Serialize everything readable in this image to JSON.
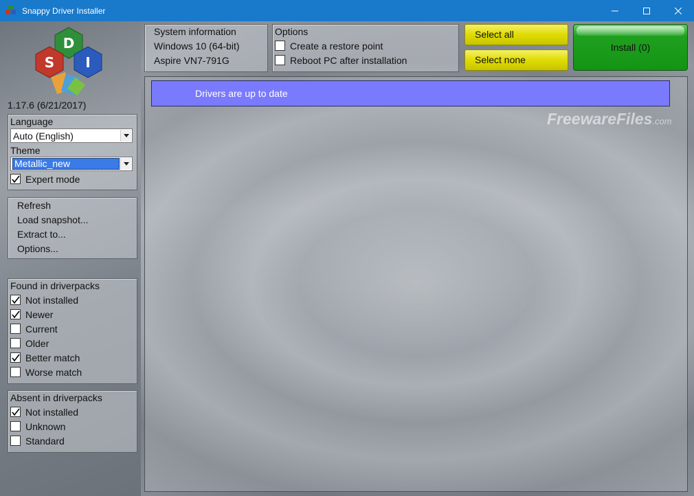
{
  "window": {
    "title": "Snappy Driver Installer"
  },
  "logo": {
    "letters": [
      "D",
      "S",
      "I"
    ]
  },
  "version": "1.17.6 (6/21/2017)",
  "settings": {
    "language_label": "Language",
    "language_value": "Auto (English)",
    "theme_label": "Theme",
    "theme_value": "Metallic_new",
    "expert_mode_label": "Expert mode",
    "expert_mode_checked": true
  },
  "actions": [
    "Refresh",
    "Load snapshot...",
    "Extract to...",
    "Options..."
  ],
  "found": {
    "title": "Found in driverpacks",
    "items": [
      {
        "label": "Not installed",
        "checked": true
      },
      {
        "label": "Newer",
        "checked": true
      },
      {
        "label": "Current",
        "checked": false
      },
      {
        "label": "Older",
        "checked": false
      },
      {
        "label": "Better match",
        "checked": true
      },
      {
        "label": "Worse match",
        "checked": false
      }
    ]
  },
  "absent": {
    "title": "Absent in driverpacks",
    "items": [
      {
        "label": "Not installed",
        "checked": true
      },
      {
        "label": "Unknown",
        "checked": false
      },
      {
        "label": "Standard",
        "checked": false
      }
    ]
  },
  "sysinfo": {
    "title": "System information",
    "os": "Windows 10 (64-bit)",
    "model": "Aspire VN7-791G"
  },
  "options": {
    "title": "Options",
    "items": [
      {
        "label": "Create a restore point",
        "checked": false
      },
      {
        "label": "Reboot PC after installation",
        "checked": false
      }
    ]
  },
  "buttons": {
    "select_all": "Select all",
    "select_none": "Select none",
    "install": "Install (0)"
  },
  "status": {
    "message": "Drivers are up to date"
  },
  "watermark": {
    "name": "FreewareFiles",
    "suffix": ".com"
  },
  "colors": {
    "titlebar": "#1979ca",
    "status_bg": "#7a7aff",
    "install_green": "#149414",
    "select_yellow": "#e0dc00"
  }
}
